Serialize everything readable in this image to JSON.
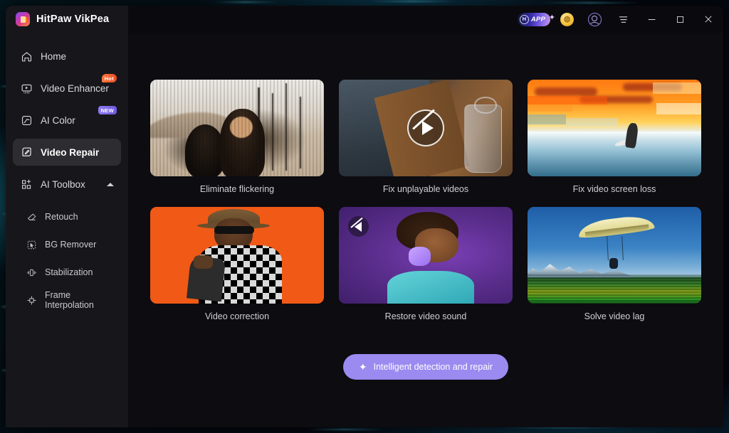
{
  "window": {
    "app_title": "HitPaw VikPea",
    "logo_icon": "hitpaw-logo-icon"
  },
  "titlebar": {
    "app_badge": {
      "label": "APP",
      "mark": "H",
      "icon": "app-badge-icon"
    },
    "coin_icon": "coin-icon",
    "avatar_icon": "account-avatar-icon",
    "menu_icon": "hamburger-menu-icon",
    "minimize_icon": "minimize-icon",
    "maximize_icon": "maximize-icon",
    "close_icon": "close-icon"
  },
  "sidebar": {
    "items": [
      {
        "label": "Home",
        "icon": "home-icon",
        "badge": null,
        "active": false
      },
      {
        "label": "Video Enhancer",
        "icon": "video-enhancer-icon",
        "badge": "Hot",
        "badge_type": "hot",
        "active": false
      },
      {
        "label": "AI Color",
        "icon": "ai-color-icon",
        "badge": "NEW",
        "badge_type": "new",
        "active": false
      },
      {
        "label": "Video Repair",
        "icon": "video-repair-icon",
        "badge": null,
        "active": true
      },
      {
        "label": "AI Toolbox",
        "icon": "ai-toolbox-icon",
        "badge": null,
        "active": false,
        "expanded": true
      }
    ],
    "sub_items": [
      {
        "label": "Retouch",
        "icon": "retouch-icon"
      },
      {
        "label": "BG Remover",
        "icon": "bg-remover-icon"
      },
      {
        "label": "Stabilization",
        "icon": "stabilization-icon"
      },
      {
        "label": "Frame Interpolation",
        "icon": "frame-interpolation-icon"
      }
    ]
  },
  "main": {
    "cards": [
      {
        "caption": "Eliminate flickering",
        "art": "art-flicker",
        "overlay": null
      },
      {
        "caption": "Fix unplayable videos",
        "art": "art-unplay",
        "overlay": "play-disabled-icon"
      },
      {
        "caption": "Fix video screen loss",
        "art": "art-loss",
        "overlay": null
      },
      {
        "caption": "Video correction",
        "art": "art-correct",
        "overlay": null
      },
      {
        "caption": "Restore video sound",
        "art": "art-sound",
        "overlay": "mute-icon"
      },
      {
        "caption": "Solve video lag",
        "art": "art-lag",
        "overlay": null
      }
    ],
    "cta": {
      "label": "Intelligent detection and repair",
      "icon": "sparkle-icon"
    }
  },
  "colors": {
    "accent": "#9b8af0",
    "sidebar_bg": "#17171b",
    "main_bg": "#0c0c11",
    "active_item_bg": "#2c2c31",
    "badge_hot": "#ef4a23",
    "badge_new": "#6f5ae0"
  }
}
